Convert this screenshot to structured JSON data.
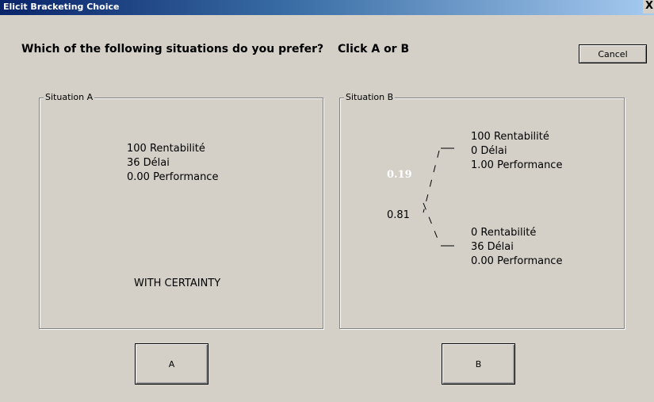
{
  "window": {
    "title": "Elicit Bracketing Choice",
    "close_glyph": "X"
  },
  "header": {
    "question": "Which of the following situations do you prefer?",
    "instruction": "Click A or B",
    "cancel_label": "Cancel"
  },
  "situation_a": {
    "label": "Situation A",
    "lines": [
      "100 Rentabilité",
      "36 Délai",
      "0.00 Performance"
    ],
    "certainty": "WITH CERTAINTY"
  },
  "situation_b": {
    "label": "Situation B",
    "outcome_high": {
      "probability": "0.19",
      "lines": [
        "100 Rentabilité",
        "0 Délai",
        "1.00 Performance"
      ]
    },
    "outcome_low": {
      "probability": "0.81",
      "lines": [
        "0 Rentabilité",
        "36 Délai",
        "0.00 Performance"
      ]
    }
  },
  "buttons": {
    "a_label": "A",
    "b_label": "B"
  },
  "colors": {
    "window_bg": "#d4d0c8",
    "title_gradient_start": "#0a246a",
    "title_gradient_end": "#a6caf0",
    "highlight_probability": "#ffffff"
  }
}
